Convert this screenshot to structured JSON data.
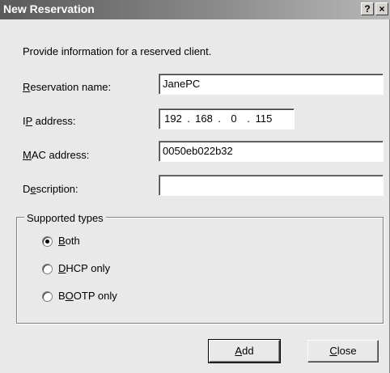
{
  "window": {
    "title": "New Reservation",
    "help_glyph": "?",
    "close_glyph": "×"
  },
  "intro": "Provide information for a reserved client.",
  "fields": {
    "reservation_name": {
      "label_accel": "R",
      "label_rest": "eservation name:",
      "value": "JanePC"
    },
    "ip_address": {
      "label_pre": "I",
      "label_accel": "P",
      "label_rest": " address:",
      "octets": [
        "192",
        "168",
        "0",
        "115"
      ]
    },
    "mac_address": {
      "label_accel": "M",
      "label_rest": "AC address:",
      "value": "0050eb022b32"
    },
    "description": {
      "label_pre": "D",
      "label_accel": "e",
      "label_rest": "scription:",
      "value": ""
    }
  },
  "supported_types": {
    "legend": "Supported types",
    "options": [
      {
        "pre": "",
        "accel": "B",
        "rest": "oth",
        "selected": true
      },
      {
        "pre": "",
        "accel": "D",
        "rest": "HCP only",
        "selected": false
      },
      {
        "pre": "B",
        "accel": "O",
        "rest": "OTP only",
        "selected": false
      }
    ]
  },
  "buttons": {
    "add": {
      "accel": "A",
      "rest": "dd"
    },
    "close": {
      "accel": "C",
      "rest": "lose"
    }
  }
}
